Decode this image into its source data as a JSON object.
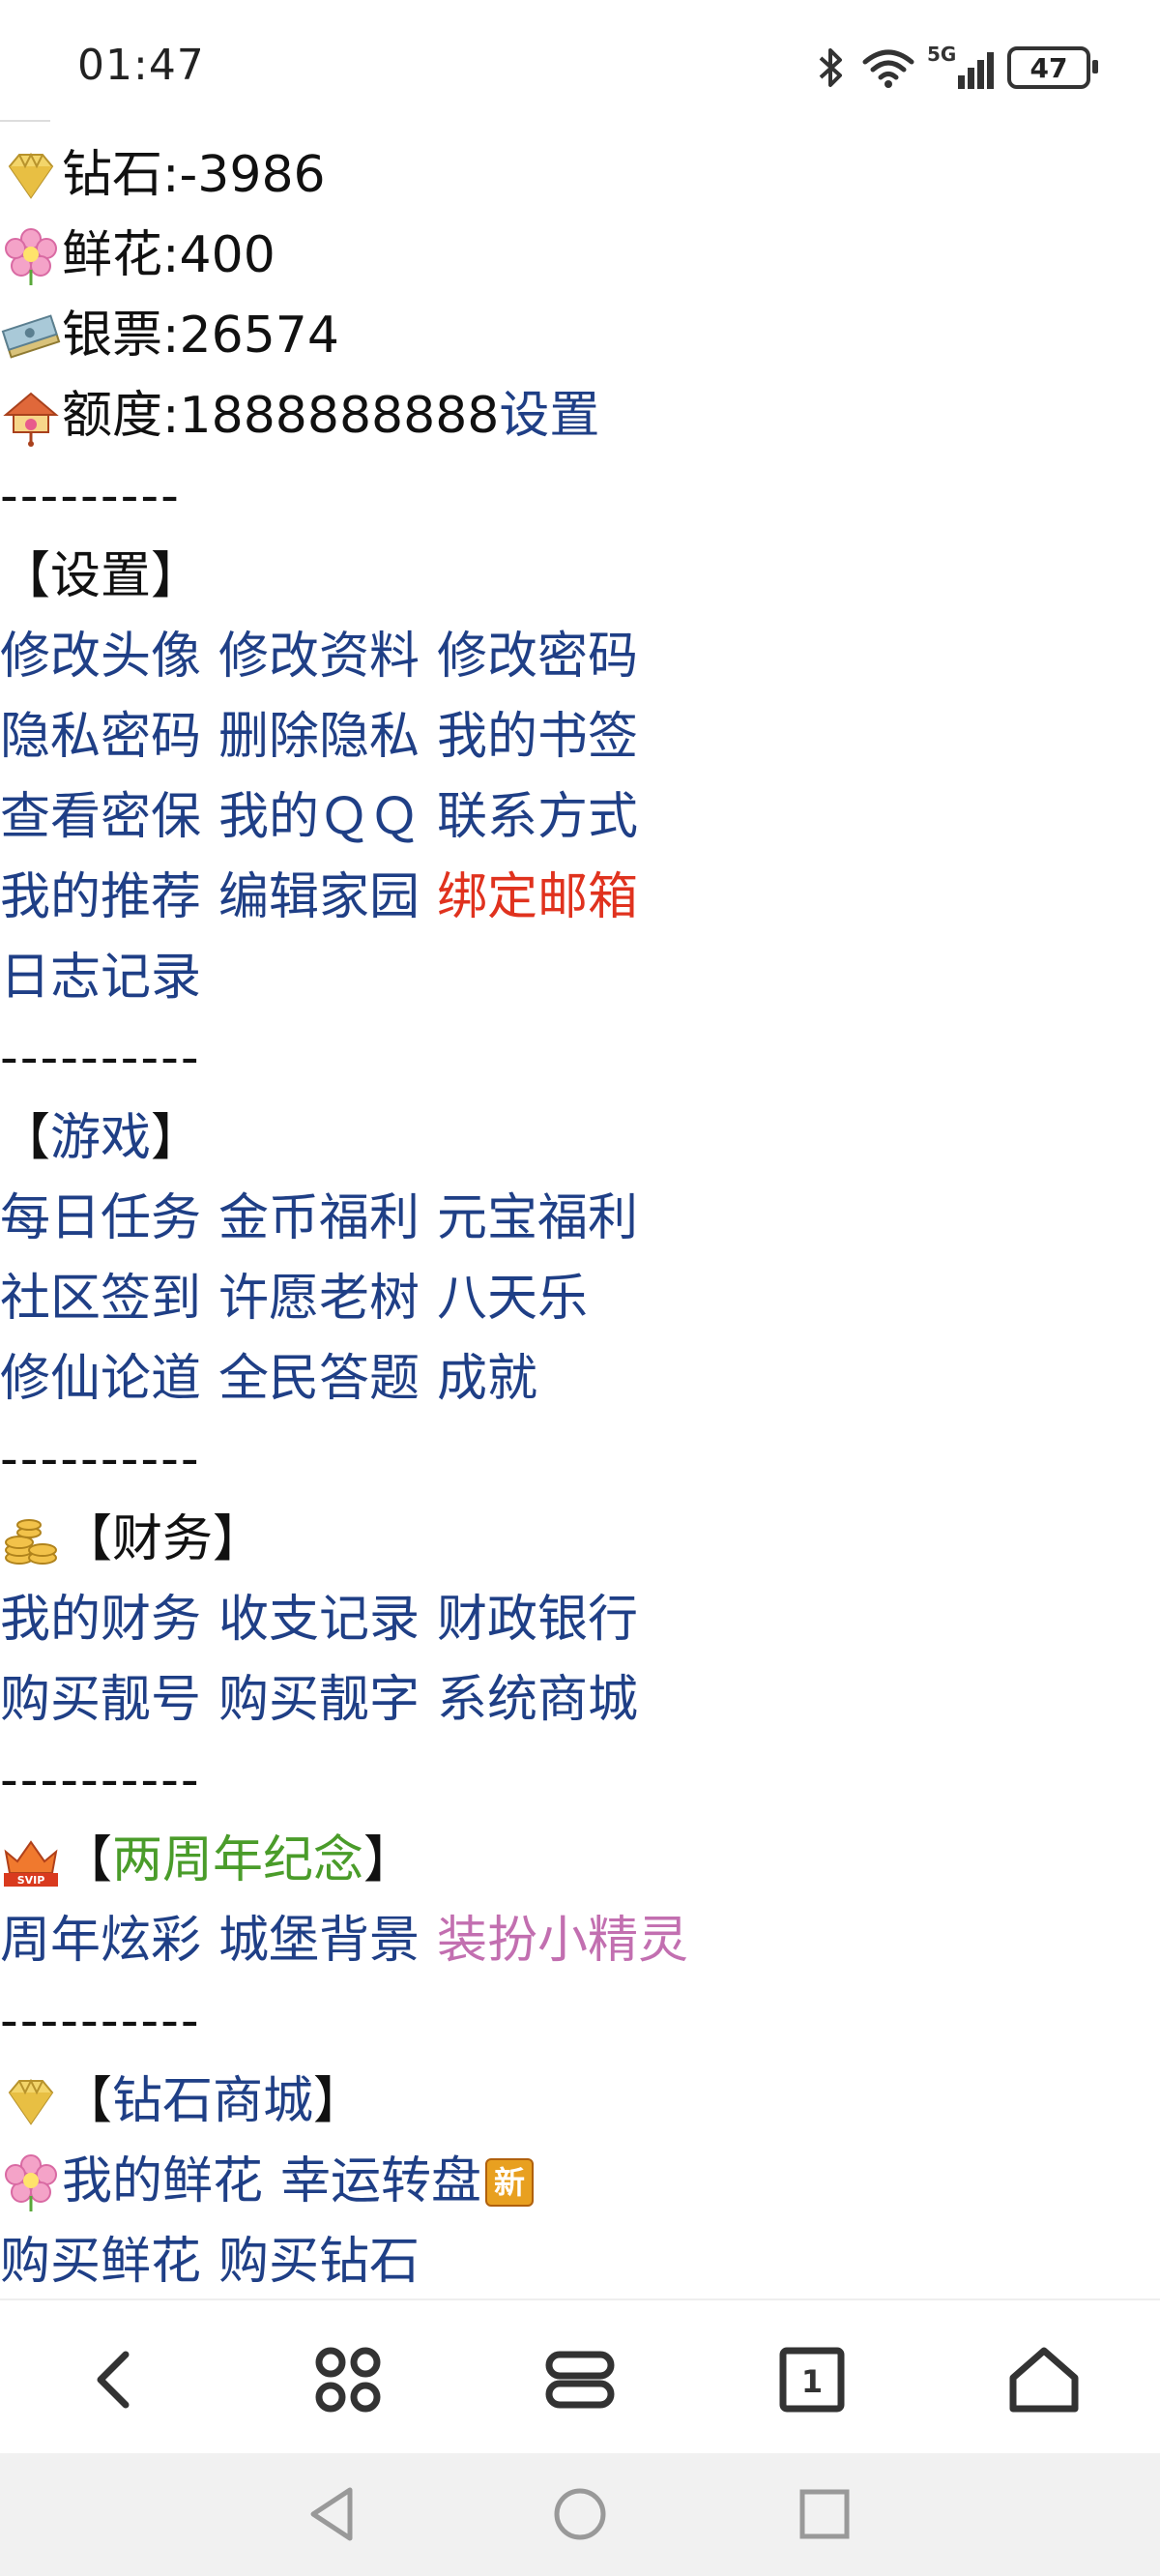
{
  "status": {
    "time": "01:47",
    "battery": "47",
    "signal": "5G"
  },
  "stats": [
    {
      "icon": "diamond-icon",
      "label": "钻石:-3986"
    },
    {
      "icon": "flower-icon",
      "label": "鲜花:400"
    },
    {
      "icon": "banknote-icon",
      "label": "银票:26574"
    },
    {
      "icon": "house-icon",
      "label": "额度:1888888888",
      "link": "设置"
    }
  ],
  "dividers": {
    "d1": "---------",
    "d2": "----------"
  },
  "sections": {
    "settings": {
      "title": "【设置】",
      "rows": [
        [
          "修改头像",
          "修改资料",
          "修改密码"
        ],
        [
          "隐私密码",
          "删除隐私",
          "我的书签"
        ],
        [
          "查看密保",
          "我的ＱＱ",
          "联系方式"
        ],
        [
          "我的推荐",
          "编辑家园",
          "绑定邮箱"
        ],
        [
          "日志记录"
        ]
      ]
    },
    "games": {
      "title_open": "【",
      "title": "游戏",
      "title_close": "】",
      "rows": [
        [
          "每日任务",
          "金币福利",
          "元宝福利"
        ],
        [
          "社区签到",
          "许愿老树",
          "八天乐"
        ],
        [
          "修仙论道",
          "全民答题",
          "成就"
        ]
      ]
    },
    "finance": {
      "icon": "coins-icon",
      "title": "【财务】",
      "rows": [
        [
          "我的财务",
          "收支记录",
          "财政银行"
        ],
        [
          "购买靓号",
          "购买靓字",
          "系统商城"
        ]
      ]
    },
    "anniversary": {
      "icon": "svip-crown-icon",
      "title_open": "【",
      "title": "两周年纪念",
      "title_close": "】",
      "rows": [
        [
          "周年炫彩",
          "城堡背景",
          "装扮小精灵"
        ]
      ]
    },
    "diamond_shop": {
      "icon": "diamond-icon",
      "title_open": "【",
      "title": "钻石商城",
      "title_close": "】",
      "rows": [
        [
          "我的鲜花",
          "幸运转盘"
        ],
        [
          "购买鲜花",
          "购买钻石"
        ]
      ],
      "new_badge": "新"
    }
  },
  "colors": {
    "link": "#1f3f86",
    "highlight_red": "#e0321e",
    "green": "#4a9c2a",
    "pink": "#c26fb0"
  }
}
